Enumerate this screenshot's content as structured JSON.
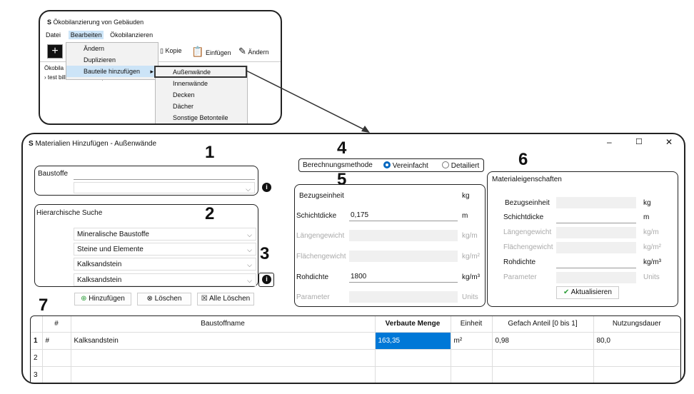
{
  "mini_app": {
    "title": "Ökobilanzierung von Gebäuden",
    "menu": [
      "Datei",
      "Bearbeiten",
      "Ökobilanzieren"
    ],
    "toolbar": {
      "copy": "Kopie",
      "paste": "Einfügen",
      "edit": "Ändern"
    },
    "tree_label": "Ökobila",
    "tree_item": "test bill of material duplicates",
    "edit_menu": [
      "Ändern",
      "Duplizieren",
      "Bauteile hinzufügen"
    ],
    "submenu": [
      "Außenwände",
      "Innenwände",
      "Decken",
      "Dächer",
      "Sonstige Betonteile"
    ]
  },
  "dialog": {
    "title": "Materialien Hinzufügen - Außenwände",
    "callouts": [
      "1",
      "2",
      "3",
      "4",
      "5",
      "6",
      "7"
    ],
    "baustoffe_label": "Baustoffe",
    "hier_label": "Hierarchische Suche",
    "hier_values": [
      "Mineralische Baustoffe",
      "Steine und Elemente",
      "Kalksandstein",
      "Kalksandstein"
    ],
    "buttons": {
      "add": "Hinzufügen",
      "delete": "Löschen",
      "delete_all": "Alle Löschen",
      "update": "Aktualisieren"
    },
    "method": {
      "label": "Berechnungsmethode",
      "opt1": "Vereinfacht",
      "opt2": "Detailiert"
    },
    "calc": {
      "rows": [
        {
          "label": "Bezugseinheit",
          "value": "",
          "unit": "kg"
        },
        {
          "label": "Schichtdicke",
          "value": "0,175",
          "unit": "m"
        },
        {
          "label": "Längengewicht",
          "value": "",
          "unit": "kg/m"
        },
        {
          "label": "Flächengewicht",
          "value": "",
          "unit": "kg/m²"
        },
        {
          "label": "Rohdichte",
          "value": "1800",
          "unit": "kg/m³"
        },
        {
          "label": "Parameter",
          "value": "",
          "unit": "Units"
        }
      ]
    },
    "props": {
      "title": "Materialeigenschaften",
      "rows": [
        {
          "label": "Bezugseinheit",
          "unit": "kg"
        },
        {
          "label": "Schichtdicke",
          "unit": "m"
        },
        {
          "label": "Längengewicht",
          "unit": "kg/m"
        },
        {
          "label": "Flächengewicht",
          "unit": "kg/m²"
        },
        {
          "label": "Rohdichte",
          "unit": "kg/m³"
        },
        {
          "label": "Parameter",
          "unit": "Units"
        }
      ]
    },
    "table": {
      "headers": [
        "#",
        "Baustoffname",
        "Verbaute Menge",
        "Einheit",
        "Gefach Anteil [0 bis 1]",
        "Nutzungsdauer"
      ],
      "rows": [
        {
          "n": "1",
          "hash": "#",
          "name": "Kalksandstein",
          "menge": "163,35",
          "einheit": "m²",
          "anteil": "0,98",
          "dauer": "80,0"
        },
        {
          "n": "2",
          "hash": "",
          "name": "",
          "menge": "",
          "einheit": "",
          "anteil": "",
          "dauer": ""
        },
        {
          "n": "3",
          "hash": "",
          "name": "",
          "menge": "",
          "einheit": "",
          "anteil": "",
          "dauer": ""
        }
      ]
    }
  }
}
